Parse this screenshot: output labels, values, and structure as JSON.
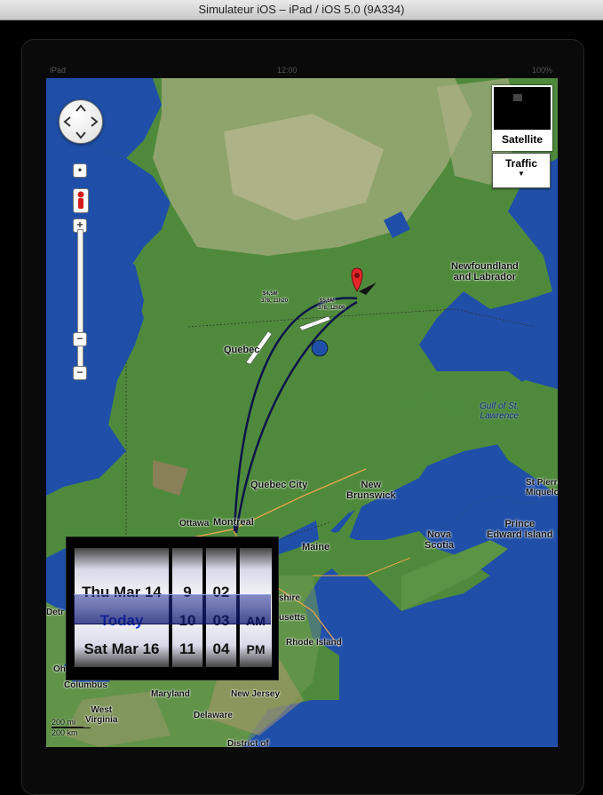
{
  "window": {
    "title": "Simulateur iOS – iPad / iOS 5.0 (9A334)"
  },
  "status_bar": {
    "left": "iPad",
    "center": "12:00",
    "right": "100%"
  },
  "map": {
    "controls": {
      "zoom_in": "+",
      "zoom_out": "−",
      "zoom_out_alt": "−"
    },
    "map_type": {
      "satellite_label": "Satellite",
      "traffic_label": "Traffic"
    },
    "labels": [
      {
        "id": "newfoundland",
        "text": "Newfoundland\nand Labrador"
      },
      {
        "id": "gulf",
        "text": "Gulf of St.\nLawrence"
      },
      {
        "id": "quebec",
        "text": "Quebec"
      },
      {
        "id": "quebec-city",
        "text": "Quebec City"
      },
      {
        "id": "new-brunswick",
        "text": "New\nBrunswick"
      },
      {
        "id": "pei",
        "text": "Prince\nEdward Island"
      },
      {
        "id": "nova-scotia",
        "text": "Nova\nScotia"
      },
      {
        "id": "st-pierre",
        "text": "St Pierre\nMiquelon"
      },
      {
        "id": "ottawa",
        "text": "Ottawa"
      },
      {
        "id": "montreal",
        "text": "Montreal"
      },
      {
        "id": "maine",
        "text": "Maine"
      },
      {
        "id": "hampshire",
        "text": "shire"
      },
      {
        "id": "massachusetts",
        "text": "usetts"
      },
      {
        "id": "rhode-island",
        "text": "Rhode Island"
      },
      {
        "id": "new-jersey",
        "text": "New Jersey"
      },
      {
        "id": "maryland",
        "text": "Maryland"
      },
      {
        "id": "delaware",
        "text": "Delaware"
      },
      {
        "id": "west-virginia",
        "text": "West\nVirginia"
      },
      {
        "id": "columbus",
        "text": "Columbus"
      },
      {
        "id": "detroit",
        "text": "Detr"
      },
      {
        "id": "ohio",
        "text": "Oh"
      },
      {
        "id": "district",
        "text": "District of"
      }
    ],
    "flight_labels": [
      {
        "id": "flight-1",
        "price": "$4,5M",
        "info": "378, 11h20"
      },
      {
        "id": "flight-2",
        "price": "$5,5M",
        "info": "378, 12h06"
      }
    ],
    "scale": {
      "top": "200 mi",
      "bottom": "200 km"
    }
  },
  "date_picker": {
    "dates": [
      "Thu Mar 14",
      "Today",
      "Sat Mar 16"
    ],
    "hours": [
      "9",
      "10",
      "11"
    ],
    "minutes": [
      "02",
      "03",
      "04"
    ],
    "ampm": [
      "",
      "AM",
      "PM"
    ]
  },
  "colors": {
    "water": "#1f4fa8",
    "land": "#4f8a3c",
    "selection": "#2a3a9c",
    "today": "#1533d6"
  }
}
